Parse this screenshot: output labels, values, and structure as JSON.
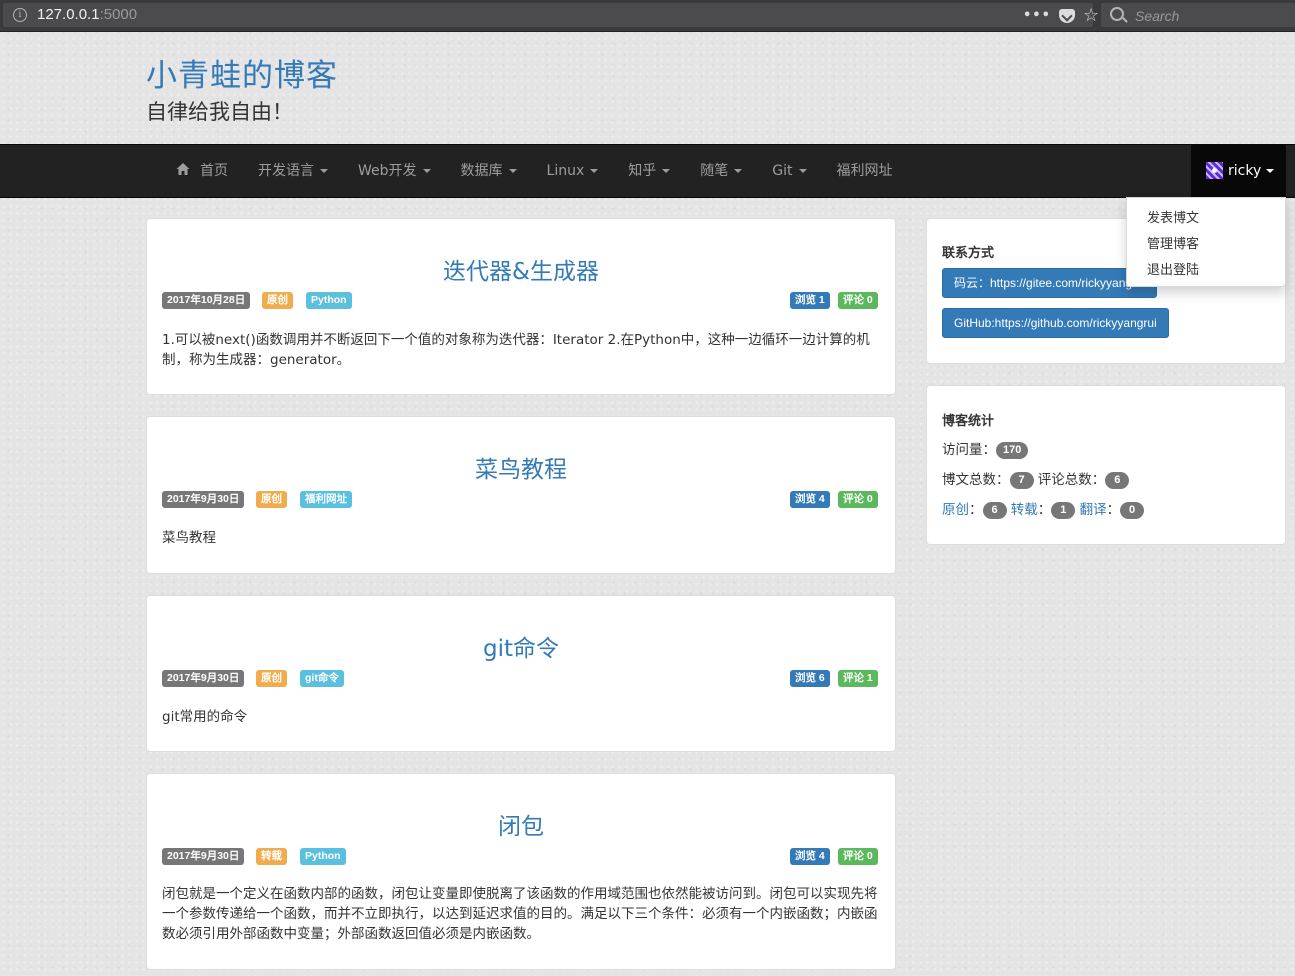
{
  "browser": {
    "url_host": "127.0.0.1",
    "url_port": ":5000",
    "more": "•••",
    "star": "☆",
    "search_placeholder": "Search"
  },
  "header": {
    "title": "小青蛙的博客",
    "subtitle": "自律给我自由！"
  },
  "nav": {
    "home": "首页",
    "items": [
      "开发语言",
      "Web开发",
      "数据库",
      "Linux",
      "知乎",
      "随笔",
      "Git"
    ],
    "plain": "福利网址",
    "user": "ricky",
    "dropdown": [
      "发表博文",
      "管理博客",
      "退出登陆"
    ]
  },
  "posts": [
    {
      "title": "迭代器&生成器",
      "date": "2017年10月28日",
      "type": "原创",
      "tag": "Python",
      "views": "浏览 1",
      "comments": "评论 0",
      "summary": "1.可以被next()函数调用并不断返回下一个值的对象称为迭代器：Iterator 2.在Python中，这种一边循环一边计算的机制，称为生成器：generator。"
    },
    {
      "title": "菜鸟教程",
      "date": "2017年9月30日",
      "type": "原创",
      "tag": "福利网址",
      "views": "浏览 4",
      "comments": "评论 0",
      "summary": "菜鸟教程"
    },
    {
      "title": "git命令",
      "date": "2017年9月30日",
      "type": "原创",
      "tag": "git命令",
      "views": "浏览 6",
      "comments": "评论 1",
      "summary": "git常用的命令"
    },
    {
      "title": "闭包",
      "date": "2017年9月30日",
      "type": "转载",
      "tag": "Python",
      "views": "浏览 4",
      "comments": "评论 0",
      "summary": "闭包就是一个定义在函数内部的函数，闭包让变量即使脱离了该函数的作用域范围也依然能被访问到。闭包可以实现先将一个参数传递给一个函数，而并不立即执行，以达到延迟求值的目的。满足以下三个条件：必须有一个内嵌函数；内嵌函数必须引用外部函数中变量；外部函数返回值必须是内嵌函数。"
    }
  ],
  "sidebar": {
    "contact_title": "联系方式",
    "gitee": "码云：https://gitee.com/rickyyangrui",
    "github": "GitHub:https://github.com/rickyyangrui",
    "stats_title": "博客统计",
    "visits_label": "访问量：",
    "visits": "170",
    "posts_label": "博文总数：",
    "posts": "7",
    "comments_label": "评论总数：",
    "comments": "6",
    "orig_label": "原创",
    "orig": "6",
    "repost_label": "转载",
    "repost": "1",
    "translate_label": "翻译",
    "translate": "0",
    "colon": "："
  },
  "colors": {
    "primary": "#337ab7",
    "navbar": "#222222",
    "label_orig": "#f0ad4e",
    "label_tag": "#5bc0de",
    "label_comments": "#5cb85c"
  }
}
